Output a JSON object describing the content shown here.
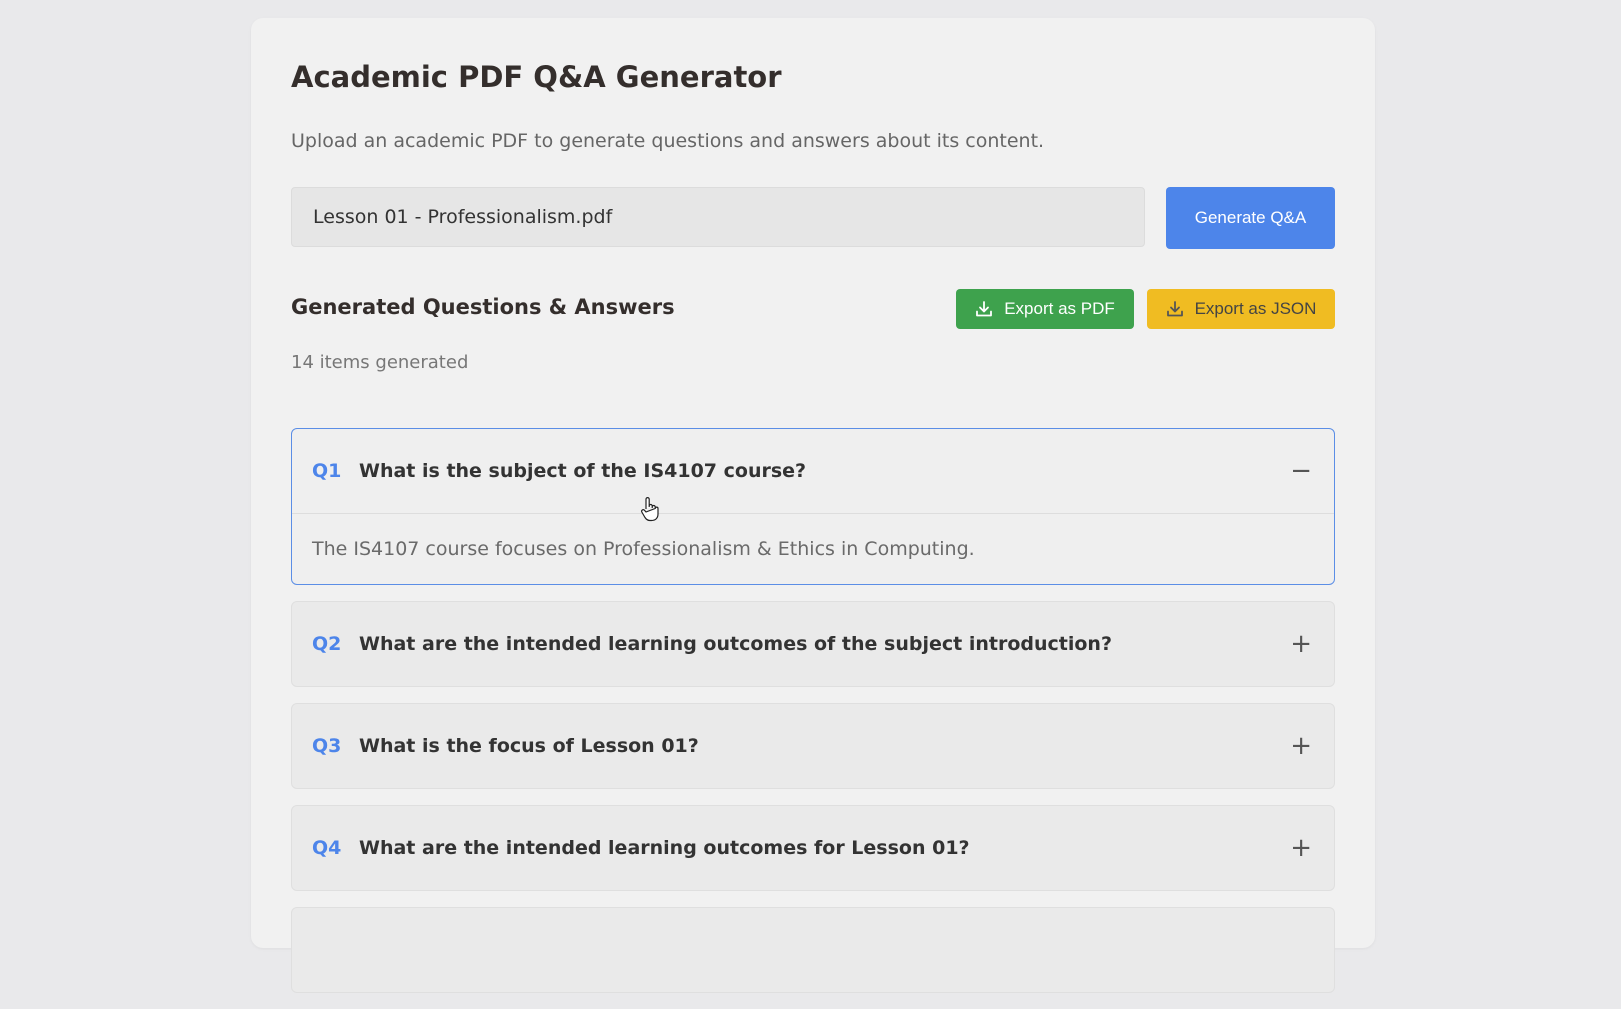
{
  "header": {
    "title": "Academic PDF Q&A Generator",
    "subtitle": "Upload an academic PDF to generate questions and answers about its content."
  },
  "upload": {
    "file_name": "Lesson 01 - Professionalism.pdf",
    "generate_label": "Generate Q&A"
  },
  "results": {
    "section_title": "Generated Questions & Answers",
    "count_text": "14 items generated",
    "export_pdf_label": "Export as PDF",
    "export_json_label": "Export as JSON",
    "items": [
      {
        "num": "Q1",
        "question": "What is the subject of the IS4107 course?",
        "expanded": true,
        "answer": "The IS4107 course focuses on Professionalism & Ethics in Computing.",
        "toggle": "−"
      },
      {
        "num": "Q2",
        "question": "What are the intended learning outcomes of the subject introduction?",
        "expanded": false,
        "toggle": "+"
      },
      {
        "num": "Q3",
        "question": "What is the focus of Lesson 01?",
        "expanded": false,
        "toggle": "+"
      },
      {
        "num": "Q4",
        "question": "What are the intended learning outcomes for Lesson 01?",
        "expanded": false,
        "toggle": "+"
      },
      {
        "num": "",
        "question": "",
        "expanded": false,
        "toggle": ""
      }
    ]
  },
  "colors": {
    "primary": "#4d85ea",
    "export_pdf": "#3ea24d",
    "export_json": "#f0bc22",
    "background": "#e9e9eb",
    "card": "#f1f1f1"
  },
  "icons": {
    "download": "download-icon",
    "collapse": "minus-icon",
    "expand": "plus-icon",
    "cursor": "hand-pointer-icon"
  }
}
